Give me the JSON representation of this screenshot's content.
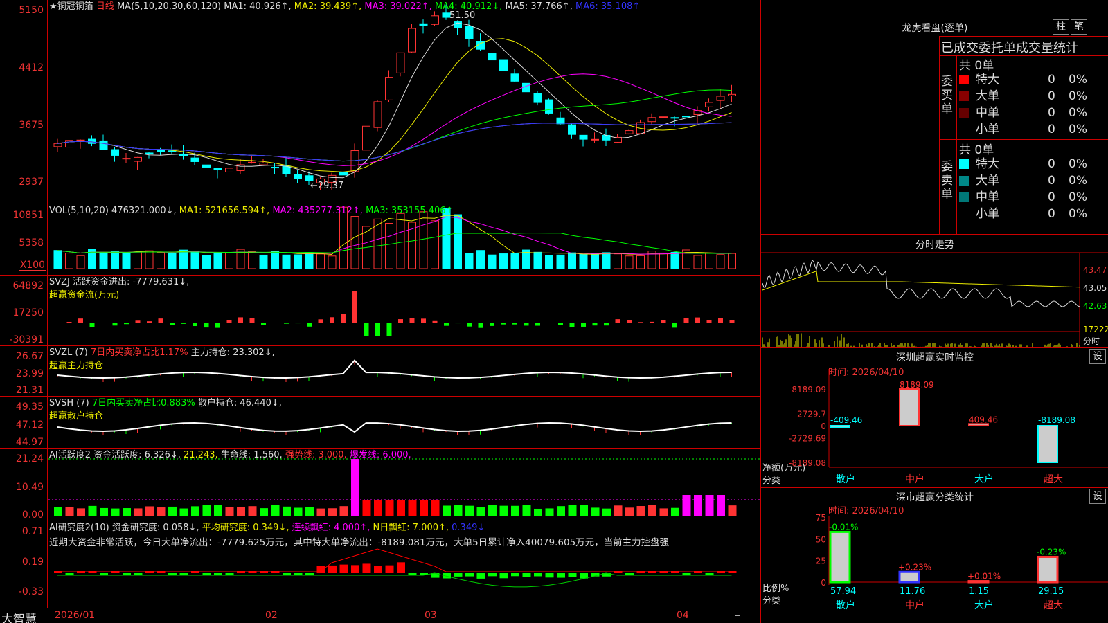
{
  "brand": "大智慧",
  "main": {
    "title": "★铜冠铜箔",
    "period": "日线",
    "ma_label": "MA(5,10,20,30,60,120)",
    "ma": [
      {
        "t": "MA1: 40.926↑,",
        "c": "#ddd"
      },
      {
        "t": "MA2: 39.439↑,",
        "c": "#ee0"
      },
      {
        "t": "MA3: 39.022↑,",
        "c": "#f0f"
      },
      {
        "t": "MA4: 40.912↓,",
        "c": "#0f0"
      },
      {
        "t": "MA5: 37.766↑,",
        "c": "#ddd"
      },
      {
        "t": "MA6: 35.108↑",
        "c": "#33f"
      }
    ],
    "y_ticks": [
      "5150",
      "4412",
      "3675",
      "2937"
    ],
    "high_label": "51.50",
    "low_label": "←29.37"
  },
  "vol": {
    "label": "VOL(5,10,20)",
    "value": "476321.000↓,",
    "ma1": "MA1: 521656.594↑,",
    "ma2": "MA2: 435277.312↑,",
    "ma3": "MA3: 353155.406↑",
    "y_ticks": [
      "10851",
      "5358"
    ],
    "unit": "X100"
  },
  "svzj": {
    "label": "SVZJ  活跃资金进出: -7779.631↓,",
    "sub": "超赢资金流(万元)",
    "y_ticks": [
      "64892",
      "17250",
      "-30391"
    ]
  },
  "svzl": {
    "label": "SVZL (7)",
    "red": "7日内买卖净占比1.17%",
    "main": "主力持仓: 23.302↓,",
    "sub": "超赢主力持仓",
    "y_ticks": [
      "26.67",
      "23.99",
      "21.31"
    ]
  },
  "svsh": {
    "label": "SVSH (7)",
    "green": "7日内买卖净占比0.883%",
    "main": "散户持仓: 46.440↓,",
    "sub": "超赢散户持仓",
    "y_ticks": [
      "49.35",
      "47.12",
      "44.97"
    ]
  },
  "ai1": {
    "label": "AI活跃度2 资金活跃度: 6.326↓,",
    "v2": "21.243,",
    "life": "生命线: 1.560,",
    "strong": "强势线: 3.000,",
    "burst": "爆发线: 6.000,",
    "y_ticks": [
      "21.24",
      "10.49",
      "0.00"
    ]
  },
  "ai2": {
    "label": "AI研究度2(10) 资金研究度: 0.058↓,",
    "avg": "平均研究度: 0.349↓,",
    "lianxu": "连续飘红: 4.000↑,",
    "nday": "N日飘红: 7.000↑,",
    "last": "0.349↓",
    "comment": "近期大资金非常活跃，今日大单净流出：-7779.625万元，其中特大单净流出：-8189.081万元，大单5日累计净入40079.605万元，当前主力控盘强",
    "y_ticks": [
      "0.71",
      "0.19",
      "-0.33"
    ]
  },
  "xaxis": [
    "2026/01",
    "02",
    "03",
    "04"
  ],
  "dragon": {
    "title": "龙虎看盘(逐单)",
    "btn1": "柱",
    "btn2": "笔",
    "subtitle": "已成交委托单成交量统计",
    "buy_label": "委买单",
    "sell_label": "委卖单",
    "buy_total": "共 0单",
    "sell_total": "共 0单",
    "buy": [
      {
        "n": "特大",
        "v": "0",
        "p": "0%",
        "c": "#f00"
      },
      {
        "n": "大单",
        "v": "0",
        "p": "0%",
        "c": "#800"
      },
      {
        "n": "中单",
        "v": "0",
        "p": "0%",
        "c": "#600"
      },
      {
        "n": "小单",
        "v": "0",
        "p": "0%",
        "c": "#000"
      }
    ],
    "sell": [
      {
        "n": "特大",
        "v": "0",
        "p": "0%",
        "c": "#0ff"
      },
      {
        "n": "大单",
        "v": "0",
        "p": "0%",
        "c": "#088"
      },
      {
        "n": "中单",
        "v": "0",
        "p": "0%",
        "c": "#077"
      },
      {
        "n": "小单",
        "v": "0",
        "p": "0%",
        "c": "#000"
      }
    ]
  },
  "fenshi": {
    "title": "分时走势",
    "y_ticks": [
      "43.47",
      "43.05",
      "42.63"
    ],
    "vol_label": "17222",
    "vol_unit": "分时"
  },
  "monitor": {
    "title": "深圳超赢实时监控",
    "btn": "设",
    "time": "时间: 2026/04/10",
    "y_ticks": [
      "8189.09",
      "2729.7",
      "0",
      "-2729.69",
      "-8189.08"
    ],
    "ylabel": "净额(万元)",
    "xcat": "分类",
    "cats": [
      "散户",
      "中户",
      "大户",
      "超大"
    ],
    "chart_data": {
      "type": "bar",
      "categories": [
        "散户",
        "中户",
        "大户",
        "超大"
      ],
      "values": [
        -409.46,
        8189.09,
        409.46,
        -8189.08
      ],
      "labels": [
        "-409.46",
        "8189.09",
        "409.46",
        "-8189.08"
      ],
      "ylim": [
        -8189.08,
        8189.09
      ]
    }
  },
  "classify": {
    "title": "深市超赢分类统计",
    "btn": "设",
    "time": "时间: 2026/04/10",
    "y_ticks": [
      "75",
      "50",
      "25",
      "0"
    ],
    "ylabel": "比例%",
    "xcat": "分类",
    "cats": [
      "散户",
      "中户",
      "大户",
      "超大"
    ],
    "chart_data": {
      "type": "bar",
      "categories": [
        "散户",
        "中户",
        "大户",
        "超大"
      ],
      "values": [
        57.94,
        11.76,
        1.15,
        29.15
      ],
      "changes": [
        "-0.01%",
        "+0.23%",
        "+0.01%",
        "-0.23%"
      ],
      "ylim": [
        0,
        75
      ]
    }
  }
}
